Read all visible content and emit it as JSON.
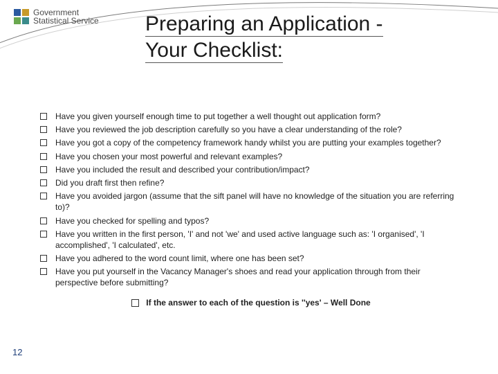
{
  "logo": {
    "line1": "Government",
    "line2": "Statistical Service"
  },
  "title": {
    "line1": "Preparing an Application -",
    "line2": "Your Checklist:"
  },
  "checklist": [
    "Have you given yourself enough time to put together a well thought out application form?",
    "Have you reviewed the job description carefully so you have a clear understanding of the role?",
    "Have you got a copy of the competency framework handy whilst you are putting your examples together?",
    "Have you chosen your most powerful and relevant examples?",
    "Have you included the result and described your contribution/impact?",
    "Did you draft first then refine?",
    "Have you avoided jargon (assume that the sift panel will have no knowledge of the situation you are referring to)?",
    "Have you checked for spelling and typos?",
    "Have you written in the first person, 'I' and not 'we' and used active language such as: 'I organised', 'I accomplished', 'I calculated', etc.",
    "Have you adhered to the word count limit, where one has been set?",
    "Have you put yourself in the Vacancy Manager's shoes and read your application through from their perspective before submitting?"
  ],
  "conclusion": "If the answer to each of the question is ''yes' – Well Done",
  "page_number": "12"
}
